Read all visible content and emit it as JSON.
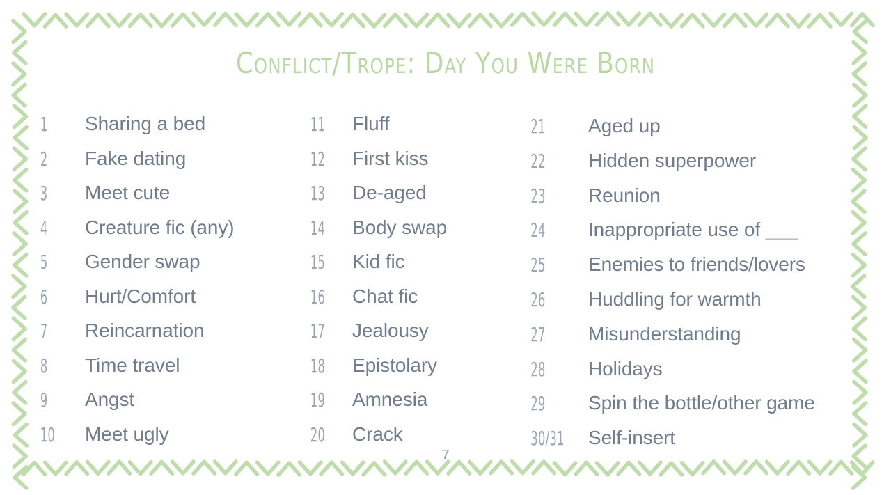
{
  "document": {
    "title": "Conflict/Trope: Day You Were Born",
    "page_number": "7",
    "accent_color": "#b9d8a3",
    "text_color": "#717c8e",
    "number_color": "#9aa6b8",
    "background_color": "#ffffff",
    "border_icon": "zigzag-chevron-border"
  },
  "columns": [
    {
      "name": "column-1",
      "items": [
        {
          "number": "1",
          "label": "Sharing a bed"
        },
        {
          "number": "2",
          "label": "Fake dating"
        },
        {
          "number": "3",
          "label": "Meet cute"
        },
        {
          "number": "4",
          "label": "Creature fic (any)"
        },
        {
          "number": "5",
          "label": "Gender swap"
        },
        {
          "number": "6",
          "label": "Hurt/Comfort"
        },
        {
          "number": "7",
          "label": "Reincarnation"
        },
        {
          "number": "8",
          "label": "Time travel"
        },
        {
          "number": "9",
          "label": "Angst"
        },
        {
          "number": "10",
          "label": "Meet ugly"
        }
      ]
    },
    {
      "name": "column-2",
      "items": [
        {
          "number": "11",
          "label": "Fluff"
        },
        {
          "number": "12",
          "label": "First kiss"
        },
        {
          "number": "13",
          "label": "De-aged"
        },
        {
          "number": "14",
          "label": "Body swap"
        },
        {
          "number": "15",
          "label": "Kid fic"
        },
        {
          "number": "16",
          "label": "Chat fic"
        },
        {
          "number": "17",
          "label": "Jealousy"
        },
        {
          "number": "18",
          "label": "Epistolary"
        },
        {
          "number": "19",
          "label": "Amnesia"
        },
        {
          "number": "20",
          "label": "Crack"
        }
      ]
    },
    {
      "name": "column-3",
      "items": [
        {
          "number": "21",
          "label": "Aged up"
        },
        {
          "number": "22",
          "label": "Hidden superpower"
        },
        {
          "number": "23",
          "label": "Reunion"
        },
        {
          "number": "24",
          "label": "Inappropriate use of ___"
        },
        {
          "number": "25",
          "label": "Enemies to friends/lovers"
        },
        {
          "number": "26",
          "label": "Huddling for warmth"
        },
        {
          "number": "27",
          "label": "Misunderstanding"
        },
        {
          "number": "28",
          "label": "Holidays"
        },
        {
          "number": "29",
          "label": "Spin the bottle/other game"
        },
        {
          "number": "30/31",
          "label": "Self-insert"
        }
      ]
    }
  ]
}
